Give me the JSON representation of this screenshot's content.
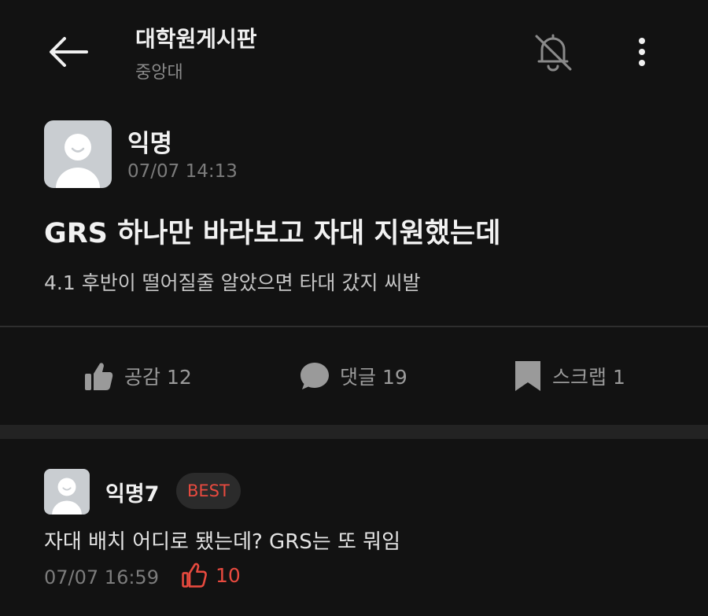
{
  "header": {
    "board_title": "대학원게시판",
    "board_sub": "중앙대",
    "icons": [
      "back-arrow-icon",
      "bell-off-icon",
      "more-vertical-icon"
    ]
  },
  "post": {
    "author": "익명",
    "time": "07/07 14:13",
    "title": "GRS 하나만 바라보고 자대 지원했는데",
    "body": "4.1 후반이 떨어질줄 알았으면 타대 갔지 씨발"
  },
  "actions": {
    "like_label": "공감 12",
    "comment_label": "댓글 19",
    "scrap_label": "스크랩 1"
  },
  "comment": {
    "author": "익명7",
    "badge": "BEST",
    "text": "자대 배치 어디로 됐는데? GRS는 또 뭐임",
    "time": "07/07 16:59",
    "like_count": "10"
  },
  "colors": {
    "background": "#121212",
    "accent_red": "#e84a3f",
    "muted_text": "#7c7c7c"
  }
}
